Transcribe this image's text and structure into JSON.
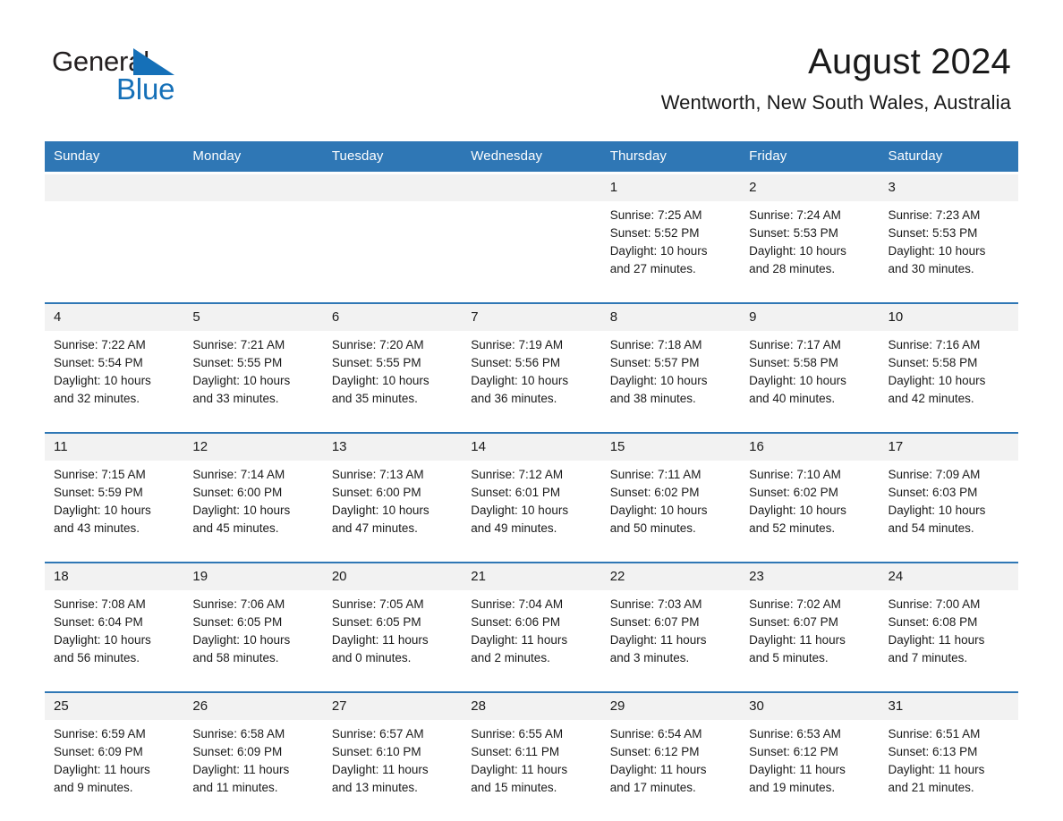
{
  "logo": {
    "word_one": "General",
    "word_two": "Blue",
    "triangle_icon": "triangle-icon",
    "accent_color": "#1570b8"
  },
  "header": {
    "title": "August 2024",
    "location": "Wentworth, New South Wales, Australia"
  },
  "theme": {
    "header_blue": "#2f77b5",
    "date_band_gray": "#f2f2f2",
    "text": "#1a1a1a"
  },
  "weekday_headers": [
    "Sunday",
    "Monday",
    "Tuesday",
    "Wednesday",
    "Thursday",
    "Friday",
    "Saturday"
  ],
  "weeks": [
    {
      "dates": [
        "",
        "",
        "",
        "",
        "1",
        "2",
        "3"
      ],
      "cells": [
        {
          "lines": []
        },
        {
          "lines": []
        },
        {
          "lines": []
        },
        {
          "lines": []
        },
        {
          "lines": [
            "Sunrise: 7:25 AM",
            "Sunset: 5:52 PM",
            "Daylight: 10 hours",
            "and 27 minutes."
          ]
        },
        {
          "lines": [
            "Sunrise: 7:24 AM",
            "Sunset: 5:53 PM",
            "Daylight: 10 hours",
            "and 28 minutes."
          ]
        },
        {
          "lines": [
            "Sunrise: 7:23 AM",
            "Sunset: 5:53 PM",
            "Daylight: 10 hours",
            "and 30 minutes."
          ]
        }
      ]
    },
    {
      "dates": [
        "4",
        "5",
        "6",
        "7",
        "8",
        "9",
        "10"
      ],
      "cells": [
        {
          "lines": [
            "Sunrise: 7:22 AM",
            "Sunset: 5:54 PM",
            "Daylight: 10 hours",
            "and 32 minutes."
          ]
        },
        {
          "lines": [
            "Sunrise: 7:21 AM",
            "Sunset: 5:55 PM",
            "Daylight: 10 hours",
            "and 33 minutes."
          ]
        },
        {
          "lines": [
            "Sunrise: 7:20 AM",
            "Sunset: 5:55 PM",
            "Daylight: 10 hours",
            "and 35 minutes."
          ]
        },
        {
          "lines": [
            "Sunrise: 7:19 AM",
            "Sunset: 5:56 PM",
            "Daylight: 10 hours",
            "and 36 minutes."
          ]
        },
        {
          "lines": [
            "Sunrise: 7:18 AM",
            "Sunset: 5:57 PM",
            "Daylight: 10 hours",
            "and 38 minutes."
          ]
        },
        {
          "lines": [
            "Sunrise: 7:17 AM",
            "Sunset: 5:58 PM",
            "Daylight: 10 hours",
            "and 40 minutes."
          ]
        },
        {
          "lines": [
            "Sunrise: 7:16 AM",
            "Sunset: 5:58 PM",
            "Daylight: 10 hours",
            "and 42 minutes."
          ]
        }
      ]
    },
    {
      "dates": [
        "11",
        "12",
        "13",
        "14",
        "15",
        "16",
        "17"
      ],
      "cells": [
        {
          "lines": [
            "Sunrise: 7:15 AM",
            "Sunset: 5:59 PM",
            "Daylight: 10 hours",
            "and 43 minutes."
          ]
        },
        {
          "lines": [
            "Sunrise: 7:14 AM",
            "Sunset: 6:00 PM",
            "Daylight: 10 hours",
            "and 45 minutes."
          ]
        },
        {
          "lines": [
            "Sunrise: 7:13 AM",
            "Sunset: 6:00 PM",
            "Daylight: 10 hours",
            "and 47 minutes."
          ]
        },
        {
          "lines": [
            "Sunrise: 7:12 AM",
            "Sunset: 6:01 PM",
            "Daylight: 10 hours",
            "and 49 minutes."
          ]
        },
        {
          "lines": [
            "Sunrise: 7:11 AM",
            "Sunset: 6:02 PM",
            "Daylight: 10 hours",
            "and 50 minutes."
          ]
        },
        {
          "lines": [
            "Sunrise: 7:10 AM",
            "Sunset: 6:02 PM",
            "Daylight: 10 hours",
            "and 52 minutes."
          ]
        },
        {
          "lines": [
            "Sunrise: 7:09 AM",
            "Sunset: 6:03 PM",
            "Daylight: 10 hours",
            "and 54 minutes."
          ]
        }
      ]
    },
    {
      "dates": [
        "18",
        "19",
        "20",
        "21",
        "22",
        "23",
        "24"
      ],
      "cells": [
        {
          "lines": [
            "Sunrise: 7:08 AM",
            "Sunset: 6:04 PM",
            "Daylight: 10 hours",
            "and 56 minutes."
          ]
        },
        {
          "lines": [
            "Sunrise: 7:06 AM",
            "Sunset: 6:05 PM",
            "Daylight: 10 hours",
            "and 58 minutes."
          ]
        },
        {
          "lines": [
            "Sunrise: 7:05 AM",
            "Sunset: 6:05 PM",
            "Daylight: 11 hours",
            "and 0 minutes."
          ]
        },
        {
          "lines": [
            "Sunrise: 7:04 AM",
            "Sunset: 6:06 PM",
            "Daylight: 11 hours",
            "and 2 minutes."
          ]
        },
        {
          "lines": [
            "Sunrise: 7:03 AM",
            "Sunset: 6:07 PM",
            "Daylight: 11 hours",
            "and 3 minutes."
          ]
        },
        {
          "lines": [
            "Sunrise: 7:02 AM",
            "Sunset: 6:07 PM",
            "Daylight: 11 hours",
            "and 5 minutes."
          ]
        },
        {
          "lines": [
            "Sunrise: 7:00 AM",
            "Sunset: 6:08 PM",
            "Daylight: 11 hours",
            "and 7 minutes."
          ]
        }
      ]
    },
    {
      "dates": [
        "25",
        "26",
        "27",
        "28",
        "29",
        "30",
        "31"
      ],
      "cells": [
        {
          "lines": [
            "Sunrise: 6:59 AM",
            "Sunset: 6:09 PM",
            "Daylight: 11 hours",
            "and 9 minutes."
          ]
        },
        {
          "lines": [
            "Sunrise: 6:58 AM",
            "Sunset: 6:09 PM",
            "Daylight: 11 hours",
            "and 11 minutes."
          ]
        },
        {
          "lines": [
            "Sunrise: 6:57 AM",
            "Sunset: 6:10 PM",
            "Daylight: 11 hours",
            "and 13 minutes."
          ]
        },
        {
          "lines": [
            "Sunrise: 6:55 AM",
            "Sunset: 6:11 PM",
            "Daylight: 11 hours",
            "and 15 minutes."
          ]
        },
        {
          "lines": [
            "Sunrise: 6:54 AM",
            "Sunset: 6:12 PM",
            "Daylight: 11 hours",
            "and 17 minutes."
          ]
        },
        {
          "lines": [
            "Sunrise: 6:53 AM",
            "Sunset: 6:12 PM",
            "Daylight: 11 hours",
            "and 19 minutes."
          ]
        },
        {
          "lines": [
            "Sunrise: 6:51 AM",
            "Sunset: 6:13 PM",
            "Daylight: 11 hours",
            "and 21 minutes."
          ]
        }
      ]
    }
  ]
}
